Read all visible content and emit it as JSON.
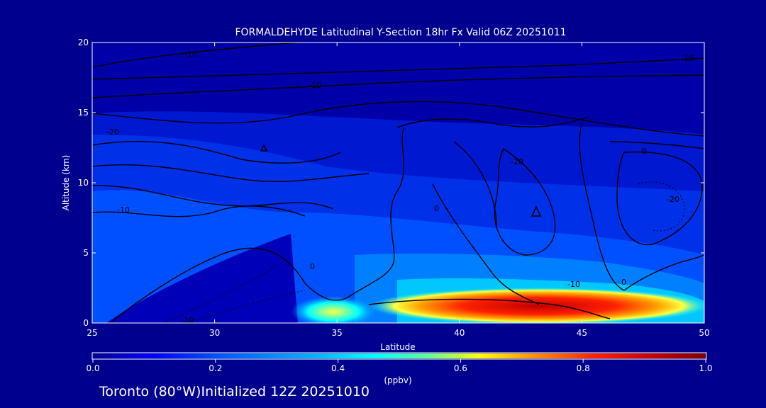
{
  "chart_data": {
    "type": "heatmap",
    "title": "FORMALDEHYDE Latitudinal Y-Section 18hr  Fx Valid 06Z 20251011",
    "xlabel": "Latitude",
    "ylabel": "Altitude (km)",
    "xlim": [
      25,
      50
    ],
    "ylim": [
      0,
      20
    ],
    "x_ticks": [
      "25",
      "30",
      "35",
      "40",
      "45",
      "50"
    ],
    "y_ticks": [
      "0",
      "5",
      "10",
      "15",
      "20"
    ],
    "colorbar": {
      "label": "(ppbv)",
      "range": [
        0.0,
        1.0
      ],
      "ticks": [
        "0.0",
        "0.2",
        "0.4",
        "0.6",
        "0.8",
        "1.0"
      ],
      "colors": [
        "#000090",
        "#0000ff",
        "#0060ff",
        "#00b0ff",
        "#00ffff",
        "#60ff90",
        "#ffff00",
        "#ff9000",
        "#ff2000",
        "#c00000",
        "#800000"
      ]
    },
    "contour_labels": [
      "-10",
      "-10",
      "-20",
      "-10",
      "-20",
      "0",
      "-20",
      "-10",
      "-10",
      "-10",
      "0",
      "0",
      "0"
    ],
    "plumes": [
      {
        "lat_range": [
          36.0,
          49.0
        ],
        "alt_peak": 0.8,
        "max_ppbv": 1.0
      },
      {
        "lat_range": [
          34.0,
          36.0
        ],
        "alt_peak": 0.6,
        "max_ppbv": 0.45
      }
    ]
  },
  "footer_text": "Toronto (80°W)Initialized 12Z 20251010"
}
